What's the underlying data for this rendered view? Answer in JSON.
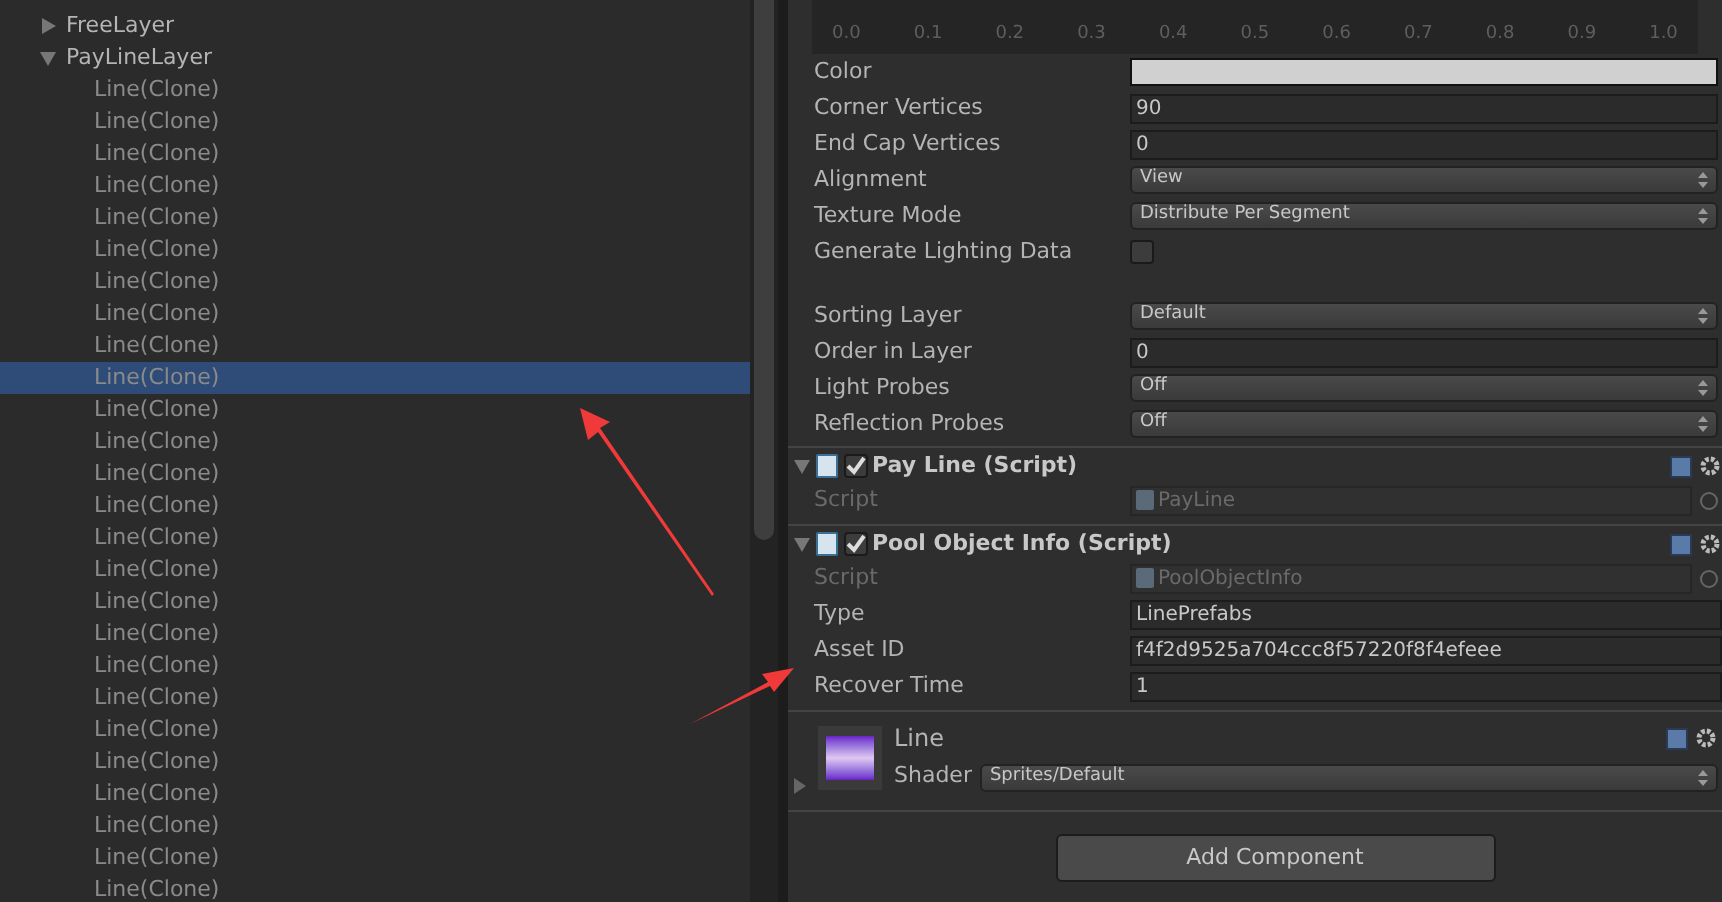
{
  "hierarchy": {
    "items": [
      {
        "label": "FreeLayer",
        "expanded": false,
        "selected": false
      },
      {
        "label": "PayLineLayer",
        "expanded": true,
        "selected": false,
        "children": [
          {
            "label": "Line(Clone)",
            "selected": false
          },
          {
            "label": "Line(Clone)",
            "selected": false
          },
          {
            "label": "Line(Clone)",
            "selected": false
          },
          {
            "label": "Line(Clone)",
            "selected": false
          },
          {
            "label": "Line(Clone)",
            "selected": false
          },
          {
            "label": "Line(Clone)",
            "selected": false
          },
          {
            "label": "Line(Clone)",
            "selected": false
          },
          {
            "label": "Line(Clone)",
            "selected": false
          },
          {
            "label": "Line(Clone)",
            "selected": false
          },
          {
            "label": "Line(Clone)",
            "selected": true
          },
          {
            "label": "Line(Clone)",
            "selected": false
          },
          {
            "label": "Line(Clone)",
            "selected": false
          },
          {
            "label": "Line(Clone)",
            "selected": false
          },
          {
            "label": "Line(Clone)",
            "selected": false
          },
          {
            "label": "Line(Clone)",
            "selected": false
          },
          {
            "label": "Line(Clone)",
            "selected": false
          },
          {
            "label": "Line(Clone)",
            "selected": false
          },
          {
            "label": "Line(Clone)",
            "selected": false
          },
          {
            "label": "Line(Clone)",
            "selected": false
          },
          {
            "label": "Line(Clone)",
            "selected": false
          },
          {
            "label": "Line(Clone)",
            "selected": false
          },
          {
            "label": "Line(Clone)",
            "selected": false
          },
          {
            "label": "Line(Clone)",
            "selected": false
          },
          {
            "label": "Line(Clone)",
            "selected": false
          },
          {
            "label": "Line(Clone)",
            "selected": false
          },
          {
            "label": "Line(Clone)",
            "selected": false
          }
        ]
      }
    ]
  },
  "inspector": {
    "curve_axis_ticks": [
      "0.0",
      "0.1",
      "0.2",
      "0.3",
      "0.4",
      "0.5",
      "0.6",
      "0.7",
      "0.8",
      "0.9",
      "1.0"
    ],
    "properties": [
      {
        "kind": "color",
        "label": "Color",
        "color": "#d0d0d0"
      },
      {
        "kind": "field",
        "label": "Corner Vertices",
        "value": "90"
      },
      {
        "kind": "field",
        "label": "End Cap Vertices",
        "value": "0"
      },
      {
        "kind": "dropdown",
        "label": "Alignment",
        "value": "View"
      },
      {
        "kind": "dropdown",
        "label": "Texture Mode",
        "value": "Distribute Per Segment"
      },
      {
        "kind": "checkbox",
        "label": "Generate Lighting Data",
        "checked": false
      },
      {
        "kind": "spacer"
      },
      {
        "kind": "dropdown",
        "label": "Sorting Layer",
        "value": "Default"
      },
      {
        "kind": "field",
        "label": "Order in Layer",
        "value": "0"
      },
      {
        "kind": "dropdown",
        "label": "Light Probes",
        "value": "Off"
      },
      {
        "kind": "dropdown",
        "label": "Reflection Probes",
        "value": "Off"
      }
    ],
    "components": [
      {
        "title": "Pay Line (Script)",
        "enabled": true,
        "fields": [
          {
            "kind": "script",
            "label": "Script",
            "value": "PayLine",
            "disabled": true
          }
        ]
      },
      {
        "title": "Pool Object Info (Script)",
        "enabled": true,
        "fields": [
          {
            "kind": "script",
            "label": "Script",
            "value": "PoolObjectInfo",
            "disabled": true
          },
          {
            "kind": "field",
            "label": "Type",
            "value": "LinePrefabs"
          },
          {
            "kind": "field",
            "label": "Asset ID",
            "value": "f4f2d9525a704ccc8f57220f8f4efeee"
          },
          {
            "kind": "field",
            "label": "Recover Time",
            "value": "1"
          }
        ]
      }
    ],
    "material": {
      "name": "Line",
      "shader_label": "Shader",
      "shader": "Sprites/Default"
    },
    "add_component": "Add Component"
  }
}
